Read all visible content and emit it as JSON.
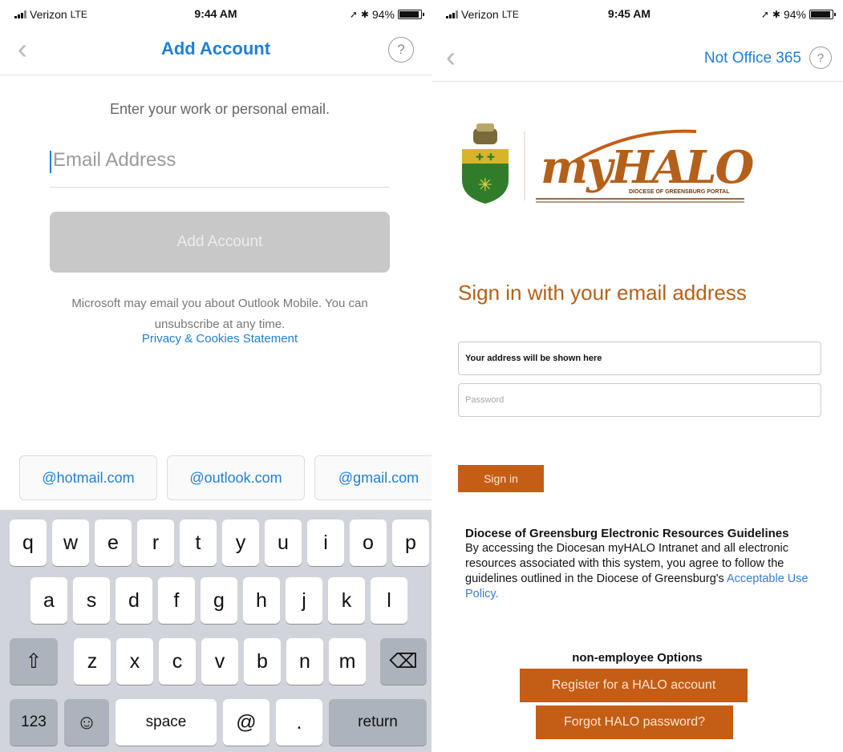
{
  "left": {
    "status": {
      "carrier": "Verizon",
      "network": "LTE",
      "time": "9:44 AM",
      "battery": "94%",
      "battery_level": 0.94
    },
    "nav": {
      "title": "Add Account",
      "help": "?"
    },
    "prompt": "Enter your work or personal email.",
    "email_placeholder": "Email Address",
    "add_button": "Add Account",
    "disclaimer": "Microsoft may email you about Outlook Mobile. You can unsubscribe at any time.",
    "privacy_link": "Privacy & Cookies Statement",
    "suggestions": [
      "@hotmail.com",
      "@outlook.com",
      "@gmail.com"
    ],
    "keyboard": {
      "row1": [
        "q",
        "w",
        "e",
        "r",
        "t",
        "y",
        "u",
        "i",
        "o",
        "p"
      ],
      "row2": [
        "a",
        "s",
        "d",
        "f",
        "g",
        "h",
        "j",
        "k",
        "l"
      ],
      "row3": [
        "z",
        "x",
        "c",
        "v",
        "b",
        "n",
        "m"
      ],
      "shift": "⇧",
      "delete": "⌫",
      "numbers": "123",
      "emoji": "☺",
      "space": "space",
      "at": "@",
      "dot": ".",
      "return": "return"
    }
  },
  "right": {
    "status": {
      "carrier": "Verizon",
      "network": "LTE",
      "time": "9:45 AM",
      "battery": "94%",
      "battery_level": 0.94
    },
    "nav": {
      "not_office": "Not Office 365",
      "help": "?"
    },
    "logo": {
      "wordmark": "myHALO",
      "tagline": "DIOCESE OF GREENSBURG PORTAL"
    },
    "heading": "Sign in with your email address",
    "address_field": "Your address will be shown here",
    "password_placeholder": "Password",
    "sign_in": "Sign in",
    "guidelines_title": "Diocese of Greensburg Electronic Resources Guidelines",
    "guidelines_body": "By accessing the Diocesan myHALO Intranet and all electronic resources associated with this system, you agree to follow the guidelines outlined in the Diocese of Greensburg's",
    "guidelines_link": "Acceptable Use Policy.",
    "nonemployee_title": "non-employee Options",
    "register_button": "Register for a HALO account",
    "forgot_button": "Forgot HALO password?"
  }
}
